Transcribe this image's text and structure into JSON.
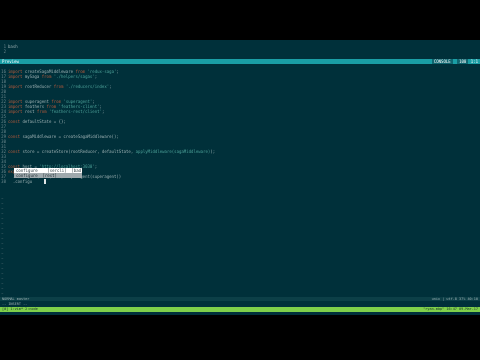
{
  "pre_lines": [
    {
      "n": "1",
      "text": "bash"
    },
    {
      "n": "2",
      "text": ""
    }
  ],
  "top_status": {
    "left": "Preview",
    "mode": "CONSOLE",
    "pos": "100",
    "right_extra": "1:1"
  },
  "code_lines": [
    {
      "n": "16",
      "tokens": [
        {
          "c": "kw",
          "t": "import "
        },
        {
          "c": "id",
          "t": "createSagaMiddleware "
        },
        {
          "c": "kw",
          "t": "from "
        },
        {
          "c": "str",
          "t": "'redux-saga'"
        },
        {
          "c": "id",
          "t": ";"
        }
      ]
    },
    {
      "n": "17",
      "tokens": [
        {
          "c": "kw",
          "t": "import "
        },
        {
          "c": "id",
          "t": "mySaga "
        },
        {
          "c": "kw",
          "t": "from "
        },
        {
          "c": "str",
          "t": "'./helpers/sagas'"
        },
        {
          "c": "id",
          "t": ";"
        }
      ]
    },
    {
      "n": "18",
      "tokens": []
    },
    {
      "n": "19",
      "tokens": [
        {
          "c": "kw",
          "t": "import "
        },
        {
          "c": "id",
          "t": "rootReducer "
        },
        {
          "c": "kw",
          "t": "from "
        },
        {
          "c": "str",
          "t": "'./reducers/index'"
        },
        {
          "c": "id",
          "t": ";"
        }
      ]
    },
    {
      "n": "20",
      "tokens": []
    },
    {
      "n": "21",
      "tokens": []
    },
    {
      "n": "22",
      "tokens": [
        {
          "c": "kw",
          "t": "import "
        },
        {
          "c": "id",
          "t": "superagent "
        },
        {
          "c": "kw",
          "t": "from "
        },
        {
          "c": "str",
          "t": "'superagent'"
        },
        {
          "c": "id",
          "t": ";"
        }
      ]
    },
    {
      "n": "23",
      "tokens": [
        {
          "c": "kw",
          "t": "import "
        },
        {
          "c": "id",
          "t": "feathers "
        },
        {
          "c": "kw",
          "t": "from "
        },
        {
          "c": "str",
          "t": "'feathers-client'"
        },
        {
          "c": "id",
          "t": ";"
        }
      ]
    },
    {
      "n": "24",
      "tokens": [
        {
          "c": "kw",
          "t": "import "
        },
        {
          "c": "id",
          "t": "rest "
        },
        {
          "c": "kw",
          "t": "from "
        },
        {
          "c": "str",
          "t": "'feathers-rest/client'"
        },
        {
          "c": "id",
          "t": ";"
        }
      ]
    },
    {
      "n": "25",
      "tokens": []
    },
    {
      "n": "26",
      "tokens": [
        {
          "c": "kw",
          "t": "const "
        },
        {
          "c": "id",
          "t": "defaultState = {};"
        }
      ]
    },
    {
      "n": "27",
      "tokens": []
    },
    {
      "n": "28",
      "tokens": []
    },
    {
      "n": "29",
      "tokens": [
        {
          "c": "kw",
          "t": "const "
        },
        {
          "c": "id",
          "t": "sagaMiddleware = createSagaMiddleware();"
        }
      ]
    },
    {
      "n": "30",
      "tokens": []
    },
    {
      "n": "31",
      "tokens": []
    },
    {
      "n": "32",
      "tokens": [
        {
          "c": "kw",
          "t": "const "
        },
        {
          "c": "id",
          "t": "store = createStore(rootReducer, defaultState, "
        },
        {
          "c": "str",
          "t": "applyMiddleware(sagaMiddleware)"
        },
        {
          "c": "id",
          "t": ");"
        }
      ]
    },
    {
      "n": "33",
      "tokens": []
    },
    {
      "n": "34",
      "tokens": []
    },
    {
      "n": "35",
      "tokens": [
        {
          "c": "kw",
          "t": "const "
        },
        {
          "c": "id",
          "t": "host = "
        },
        {
          "c": "str",
          "t": "'http://localhost:3030'"
        },
        {
          "c": "id",
          "t": ";"
        }
      ]
    },
    {
      "n": "36",
      "tokens": [
        {
          "c": "kw",
          "t": "export const "
        },
        {
          "c": "id",
          "t": "app = feathers()"
        }
      ]
    },
    {
      "n": "37",
      "tokens": [
        {
          "c": "id",
          "t": "  .configure(rest(host).superagent(superagent))"
        }
      ]
    },
    {
      "n": "38",
      "tokens": [
        {
          "c": "id",
          "t": "  .configu"
        }
      ]
    }
  ],
  "completion": [
    {
      "label": "configure    [sercli]  [bad]",
      "selected": true
    },
    {
      "label": "configure  [rest]",
      "selected": false
    }
  ],
  "empty_line_count": 26,
  "bottom_status": {
    "left": "NORMAL  master",
    "center": "unix | utf-8",
    "pos": "37%",
    "right": "40:10"
  },
  "cmdline": "-- INSERT --",
  "tmux": {
    "left": "[0] 1:vim*  2:node",
    "right": "\"ryan-mbp\" 16:47 09-Mar-17"
  }
}
